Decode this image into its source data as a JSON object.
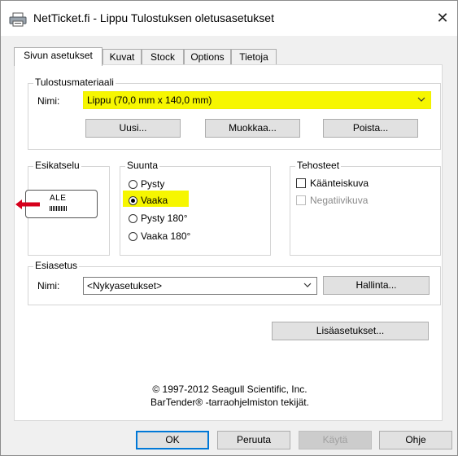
{
  "window": {
    "title": "NetTicket.fi - Lippu Tulostuksen oletusasetukset",
    "close_glyph": "✕"
  },
  "tabs": [
    "Sivun asetukset",
    "Kuvat",
    "Stock",
    "Options",
    "Tietoja"
  ],
  "material": {
    "group_title": "Tulostusmateriaali",
    "name_label": "Nimi:",
    "selected": "Lippu (70,0 mm x 140,0 mm)",
    "buttons": {
      "new": "Uusi...",
      "edit": "Muokkaa...",
      "delete": "Poista..."
    }
  },
  "preview": {
    "group_title": "Esikatselu",
    "label_text": "ALE"
  },
  "orientation": {
    "group_title": "Suunta",
    "options": [
      "Pysty",
      "Vaaka",
      "Pysty 180°",
      "Vaaka 180°"
    ],
    "selected": "Vaaka"
  },
  "effects": {
    "group_title": "Tehosteet",
    "mirror": "Käänteiskuva",
    "negative": "Negatiivikuva"
  },
  "preset": {
    "group_title": "Esiasetus",
    "name_label": "Nimi:",
    "selected": "<Nykyasetukset>",
    "manage_button": "Hallinta..."
  },
  "advanced_button": "Lisäasetukset...",
  "copyright": {
    "line1": "© 1997-2012 Seagull Scientific, Inc.",
    "line2": "BarTender® -tarraohjelmiston tekijät."
  },
  "footer": {
    "ok": "OK",
    "cancel": "Peruuta",
    "apply": "Käytä",
    "help": "Ohje"
  },
  "colors": {
    "highlight": "#f6f600",
    "accent": "#0078d7",
    "arrow": "#d6001c"
  }
}
